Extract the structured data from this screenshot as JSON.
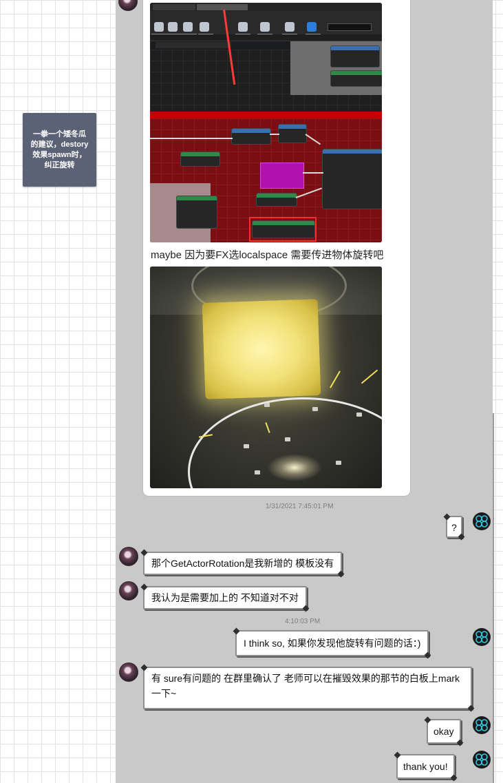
{
  "sticky_note": {
    "text": "一拳一个矮冬瓜的建议，destory 效果spawn时，纠正旋转"
  },
  "image_card": {
    "caption": "maybe  因为要FX选localspace 需要传进物体旋转吧"
  },
  "messages": [
    {
      "kind": "timestamp",
      "text": "1/31/2021 7:45:01 PM"
    },
    {
      "kind": "outgoing",
      "text": "?"
    },
    {
      "kind": "incoming",
      "text": "那个GetActorRotation是我新增的   模板没有"
    },
    {
      "kind": "incoming",
      "text": "我认为是需要加上的    不知道对不对"
    },
    {
      "kind": "timestamp",
      "text": "4:10:03 PM"
    },
    {
      "kind": "outgoing",
      "text": "I think so, 如果你发现他旋转有问题的话：)"
    },
    {
      "kind": "incoming",
      "text": "有  sure有问题的  在群里确认了   老师可以在摧毁效果的那节的白板上mark一下~"
    },
    {
      "kind": "outgoing",
      "text": "okay"
    },
    {
      "kind": "outgoing",
      "text": "thank you!"
    }
  ],
  "colors": {
    "chat_background": "#c9c9c9",
    "sticky_note": "#5c6275",
    "bubble_background": "#ffffff",
    "highlight_red": "#ff2a2a"
  },
  "icons": {
    "incoming_avatar": "user-avatar",
    "outgoing_avatar": "mono-logo-icon"
  }
}
